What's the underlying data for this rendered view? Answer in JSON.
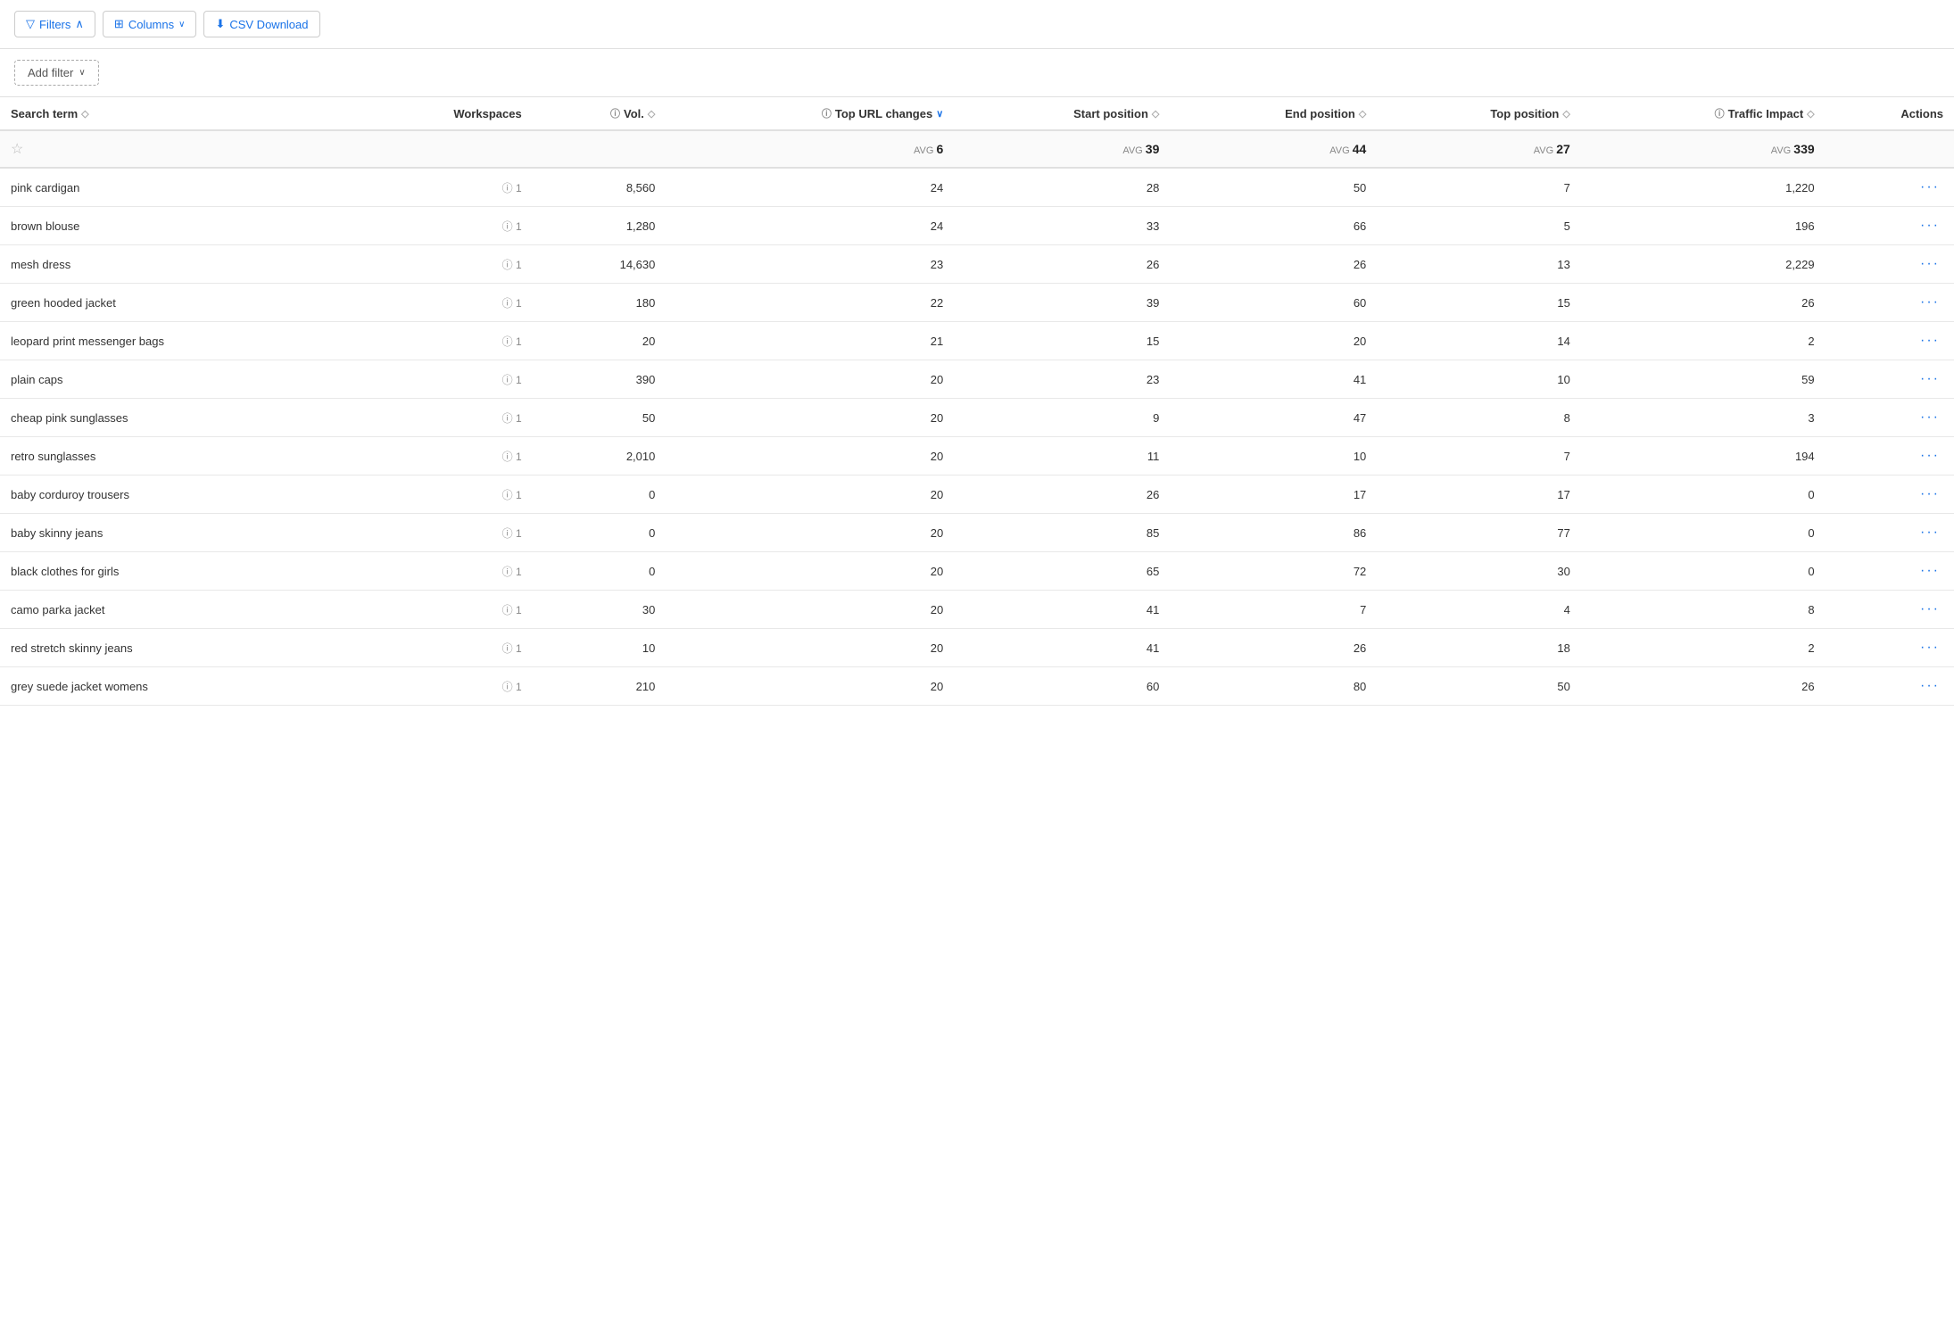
{
  "toolbar": {
    "filters_label": "Filters",
    "columns_label": "Columns",
    "csv_label": "CSV Download",
    "add_filter_label": "Add filter"
  },
  "table": {
    "columns": [
      {
        "key": "search_term",
        "label": "Search term",
        "sortable": true,
        "info": false,
        "align": "left"
      },
      {
        "key": "workspaces",
        "label": "Workspaces",
        "sortable": false,
        "info": false,
        "align": "right"
      },
      {
        "key": "vol",
        "label": "Vol.",
        "sortable": true,
        "info": true,
        "align": "right"
      },
      {
        "key": "top_url_changes",
        "label": "Top URL changes",
        "sortable": true,
        "info": true,
        "align": "right",
        "active_sort": true
      },
      {
        "key": "start_position",
        "label": "Start position",
        "sortable": true,
        "info": false,
        "align": "right"
      },
      {
        "key": "end_position",
        "label": "End position",
        "sortable": true,
        "info": false,
        "align": "right"
      },
      {
        "key": "top_position",
        "label": "Top position",
        "sortable": true,
        "info": false,
        "align": "right"
      },
      {
        "key": "traffic_impact",
        "label": "Traffic Impact",
        "sortable": true,
        "info": true,
        "align": "right"
      },
      {
        "key": "actions",
        "label": "Actions",
        "sortable": false,
        "info": false,
        "align": "right"
      }
    ],
    "averages": {
      "top_url_changes": {
        "label": "AVG",
        "value": "6"
      },
      "start_position": {
        "label": "AVG",
        "value": "39"
      },
      "end_position": {
        "label": "AVG",
        "value": "44"
      },
      "top_position": {
        "label": "AVG",
        "value": "27"
      },
      "traffic_impact": {
        "label": "AVG",
        "value": "339"
      }
    },
    "rows": [
      {
        "search_term": "pink cardigan",
        "ws": "1",
        "vol": "8,560",
        "top_url_changes": "24",
        "start_position": "28",
        "end_position": "50",
        "top_position": "7",
        "traffic_impact": "1,220"
      },
      {
        "search_term": "brown blouse",
        "ws": "1",
        "vol": "1,280",
        "top_url_changes": "24",
        "start_position": "33",
        "end_position": "66",
        "top_position": "5",
        "traffic_impact": "196"
      },
      {
        "search_term": "mesh dress",
        "ws": "1",
        "vol": "14,630",
        "top_url_changes": "23",
        "start_position": "26",
        "end_position": "26",
        "top_position": "13",
        "traffic_impact": "2,229"
      },
      {
        "search_term": "green hooded jacket",
        "ws": "1",
        "vol": "180",
        "top_url_changes": "22",
        "start_position": "39",
        "end_position": "60",
        "top_position": "15",
        "traffic_impact": "26"
      },
      {
        "search_term": "leopard print messenger bags",
        "ws": "1",
        "vol": "20",
        "top_url_changes": "21",
        "start_position": "15",
        "end_position": "20",
        "top_position": "14",
        "traffic_impact": "2"
      },
      {
        "search_term": "plain caps",
        "ws": "1",
        "vol": "390",
        "top_url_changes": "20",
        "start_position": "23",
        "end_position": "41",
        "top_position": "10",
        "traffic_impact": "59"
      },
      {
        "search_term": "cheap pink sunglasses",
        "ws": "1",
        "vol": "50",
        "top_url_changes": "20",
        "start_position": "9",
        "end_position": "47",
        "top_position": "8",
        "traffic_impact": "3"
      },
      {
        "search_term": "retro sunglasses",
        "ws": "1",
        "vol": "2,010",
        "top_url_changes": "20",
        "start_position": "11",
        "end_position": "10",
        "top_position": "7",
        "traffic_impact": "194"
      },
      {
        "search_term": "baby corduroy trousers",
        "ws": "1",
        "vol": "0",
        "top_url_changes": "20",
        "start_position": "26",
        "end_position": "17",
        "top_position": "17",
        "traffic_impact": "0"
      },
      {
        "search_term": "baby skinny jeans",
        "ws": "1",
        "vol": "0",
        "top_url_changes": "20",
        "start_position": "85",
        "end_position": "86",
        "top_position": "77",
        "traffic_impact": "0"
      },
      {
        "search_term": "black clothes for girls",
        "ws": "1",
        "vol": "0",
        "top_url_changes": "20",
        "start_position": "65",
        "end_position": "72",
        "top_position": "30",
        "traffic_impact": "0"
      },
      {
        "search_term": "camo parka jacket",
        "ws": "1",
        "vol": "30",
        "top_url_changes": "20",
        "start_position": "41",
        "end_position": "7",
        "top_position": "4",
        "traffic_impact": "8"
      },
      {
        "search_term": "red stretch skinny jeans",
        "ws": "1",
        "vol": "10",
        "top_url_changes": "20",
        "start_position": "41",
        "end_position": "26",
        "top_position": "18",
        "traffic_impact": "2"
      },
      {
        "search_term": "grey suede jacket womens",
        "ws": "1",
        "vol": "210",
        "top_url_changes": "20",
        "start_position": "60",
        "end_position": "80",
        "top_position": "50",
        "traffic_impact": "26"
      }
    ],
    "actions_label": "...",
    "info_symbol": "ⓘ",
    "sort_up": "◇",
    "sort_active": "∨"
  }
}
